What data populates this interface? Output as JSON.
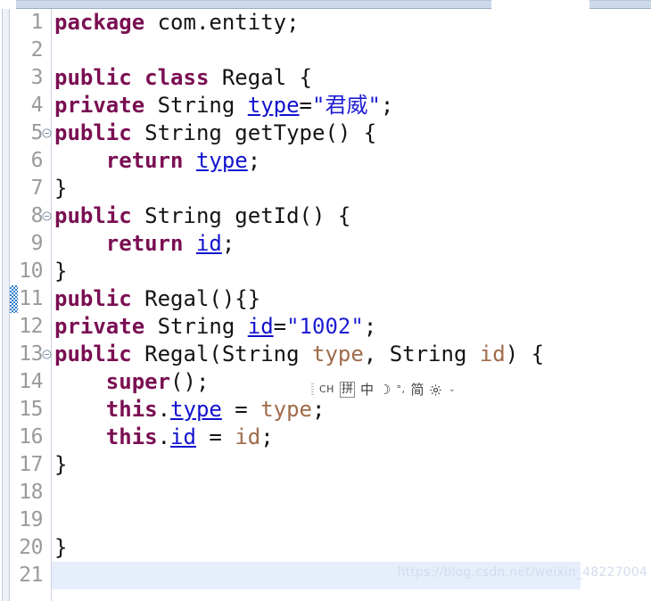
{
  "window": {
    "kind": "java-code-editor",
    "file_language": "Java",
    "background_color": "#ffffff",
    "current_line_highlight_color": "#e6eefb",
    "line_number_color": "#9a9a9a",
    "change_marker_color": "#2f7fd0"
  },
  "top_strip": {
    "left_segment_label": "",
    "right_segment_label": "",
    "color": "#ccd9ea"
  },
  "syntax_colors": {
    "keyword": "#7a0e52",
    "type": "#141414",
    "field": "#1212cf",
    "string": "#1d1dd4",
    "parameter": "#a06b4a",
    "plain": "#141414"
  },
  "editor": {
    "lines": [
      {
        "number": "1",
        "fold": false,
        "changed": false,
        "current": false,
        "text": "package com.entity;",
        "tokens": [
          {
            "t": "package",
            "c": "kw"
          },
          {
            "t": " com.entity;",
            "c": "pln"
          }
        ]
      },
      {
        "number": "2",
        "fold": false,
        "changed": false,
        "current": false,
        "text": "",
        "tokens": []
      },
      {
        "number": "3",
        "fold": false,
        "changed": false,
        "current": false,
        "text": "public class Regal {",
        "tokens": [
          {
            "t": "public",
            "c": "kw"
          },
          {
            "t": " ",
            "c": "pln"
          },
          {
            "t": "class",
            "c": "kw"
          },
          {
            "t": " Regal {",
            "c": "pln"
          }
        ]
      },
      {
        "number": "4",
        "fold": false,
        "changed": false,
        "current": false,
        "text": "private String type=\"君威\";",
        "tokens": [
          {
            "t": "private",
            "c": "kw"
          },
          {
            "t": " String ",
            "c": "typ"
          },
          {
            "t": "type",
            "c": "fld"
          },
          {
            "t": "=",
            "c": "pln"
          },
          {
            "t": "\"君威\"",
            "c": "str"
          },
          {
            "t": ";",
            "c": "pln"
          }
        ]
      },
      {
        "number": "5",
        "fold": true,
        "changed": false,
        "current": false,
        "text": "public String getType() {",
        "tokens": [
          {
            "t": "public",
            "c": "kw"
          },
          {
            "t": " String getType() {",
            "c": "typ"
          }
        ]
      },
      {
        "number": "6",
        "fold": false,
        "changed": false,
        "current": false,
        "text": "    return type;",
        "tokens": [
          {
            "t": "    ",
            "c": "pln"
          },
          {
            "t": "return",
            "c": "kw"
          },
          {
            "t": " ",
            "c": "pln"
          },
          {
            "t": "type",
            "c": "fld"
          },
          {
            "t": ";",
            "c": "pln"
          }
        ]
      },
      {
        "number": "7",
        "fold": false,
        "changed": false,
        "current": false,
        "text": "}",
        "tokens": [
          {
            "t": "}",
            "c": "pln"
          }
        ]
      },
      {
        "number": "8",
        "fold": true,
        "changed": false,
        "current": false,
        "text": "public String getId() {",
        "tokens": [
          {
            "t": "public",
            "c": "kw"
          },
          {
            "t": " String getId() {",
            "c": "typ"
          }
        ]
      },
      {
        "number": "9",
        "fold": false,
        "changed": false,
        "current": false,
        "text": "    return id;",
        "tokens": [
          {
            "t": "    ",
            "c": "pln"
          },
          {
            "t": "return",
            "c": "kw"
          },
          {
            "t": " ",
            "c": "pln"
          },
          {
            "t": "id",
            "c": "fld"
          },
          {
            "t": ";",
            "c": "pln"
          }
        ]
      },
      {
        "number": "10",
        "fold": false,
        "changed": false,
        "current": false,
        "text": "}",
        "tokens": [
          {
            "t": "}",
            "c": "pln"
          }
        ]
      },
      {
        "number": "11",
        "fold": false,
        "changed": true,
        "current": false,
        "text": "public Regal(){}",
        "tokens": [
          {
            "t": "public",
            "c": "kw"
          },
          {
            "t": " Regal(){}",
            "c": "pln"
          }
        ]
      },
      {
        "number": "12",
        "fold": false,
        "changed": false,
        "current": false,
        "text": "private String id=\"1002\";",
        "tokens": [
          {
            "t": "private",
            "c": "kw"
          },
          {
            "t": " String ",
            "c": "typ"
          },
          {
            "t": "id",
            "c": "fld"
          },
          {
            "t": "=",
            "c": "pln"
          },
          {
            "t": "\"1002\"",
            "c": "str"
          },
          {
            "t": ";",
            "c": "pln"
          }
        ]
      },
      {
        "number": "13",
        "fold": true,
        "changed": false,
        "current": false,
        "text": "public Regal(String type, String id) {",
        "tokens": [
          {
            "t": "public",
            "c": "kw"
          },
          {
            "t": " Regal(String ",
            "c": "typ"
          },
          {
            "t": "type",
            "c": "prm"
          },
          {
            "t": ", String ",
            "c": "typ"
          },
          {
            "t": "id",
            "c": "prm"
          },
          {
            "t": ") {",
            "c": "pln"
          }
        ]
      },
      {
        "number": "14",
        "fold": false,
        "changed": false,
        "current": false,
        "text": "    super();",
        "tokens": [
          {
            "t": "    ",
            "c": "pln"
          },
          {
            "t": "super",
            "c": "kw"
          },
          {
            "t": "();",
            "c": "pln"
          }
        ]
      },
      {
        "number": "15",
        "fold": false,
        "changed": false,
        "current": false,
        "text": "    this.type = type;",
        "tokens": [
          {
            "t": "    ",
            "c": "pln"
          },
          {
            "t": "this",
            "c": "kw"
          },
          {
            "t": ".",
            "c": "pln"
          },
          {
            "t": "type",
            "c": "fld"
          },
          {
            "t": " = ",
            "c": "pln"
          },
          {
            "t": "type",
            "c": "prm"
          },
          {
            "t": ";",
            "c": "pln"
          }
        ]
      },
      {
        "number": "16",
        "fold": false,
        "changed": false,
        "current": false,
        "text": "    this.id = id;",
        "tokens": [
          {
            "t": "    ",
            "c": "pln"
          },
          {
            "t": "this",
            "c": "kw"
          },
          {
            "t": ".",
            "c": "pln"
          },
          {
            "t": "id",
            "c": "fld"
          },
          {
            "t": " = ",
            "c": "pln"
          },
          {
            "t": "id",
            "c": "prm"
          },
          {
            "t": ";",
            "c": "pln"
          }
        ]
      },
      {
        "number": "17",
        "fold": false,
        "changed": false,
        "current": false,
        "text": "}",
        "tokens": [
          {
            "t": "}",
            "c": "pln"
          }
        ]
      },
      {
        "number": "18",
        "fold": false,
        "changed": false,
        "current": false,
        "text": "",
        "tokens": []
      },
      {
        "number": "19",
        "fold": false,
        "changed": false,
        "current": false,
        "text": "",
        "tokens": []
      },
      {
        "number": "20",
        "fold": false,
        "changed": false,
        "current": false,
        "text": "}",
        "tokens": [
          {
            "t": "}",
            "c": "pln"
          }
        ]
      },
      {
        "number": "21",
        "fold": false,
        "changed": false,
        "current": true,
        "text": "",
        "tokens": []
      }
    ]
  },
  "ime_toolbar": {
    "present": true,
    "items": [
      {
        "name": "drag-handle",
        "label": "",
        "type": "grip"
      },
      {
        "name": "language-indicator",
        "label": "CH",
        "type": "small-caps"
      },
      {
        "name": "pinyin-mode",
        "label": "拼",
        "type": "boxed"
      },
      {
        "name": "chinese-mode",
        "label": "中",
        "type": "cjk"
      },
      {
        "name": "tone-mode",
        "label": "☽",
        "type": "cjk"
      },
      {
        "name": "punctuation-mode",
        "label": "°,",
        "type": "small-caps"
      },
      {
        "name": "simplified-mode",
        "label": "简",
        "type": "cjk"
      },
      {
        "name": "settings-gear",
        "label": "",
        "type": "gear"
      },
      {
        "name": "expand-caret",
        "label": "⌄",
        "type": "caret"
      }
    ]
  },
  "watermark": {
    "text": "https://blog.csdn.net/weixin_48227004"
  }
}
